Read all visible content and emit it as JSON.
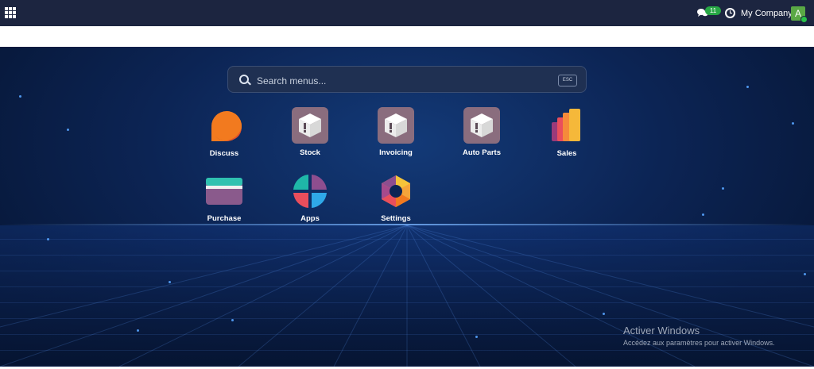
{
  "topbar": {
    "messages_count": "11",
    "company": "My Company",
    "avatar_letter": "A"
  },
  "search": {
    "placeholder": "Search menus...",
    "esc_label": "ESC"
  },
  "apps": [
    {
      "label": "Discuss"
    },
    {
      "label": "Stock"
    },
    {
      "label": "Invoicing"
    },
    {
      "label": "Auto Parts"
    },
    {
      "label": "Sales"
    },
    {
      "label": "Purchase"
    },
    {
      "label": "Apps"
    },
    {
      "label": "Settings"
    }
  ],
  "watermark": {
    "title": "Activer Windows",
    "subtitle": "Accédez aux paramètres pour activer Windows."
  },
  "colors": {
    "topbar": "#1c2540",
    "background": "#0c2454",
    "badge": "#27a745",
    "avatar": "#5aa845"
  }
}
